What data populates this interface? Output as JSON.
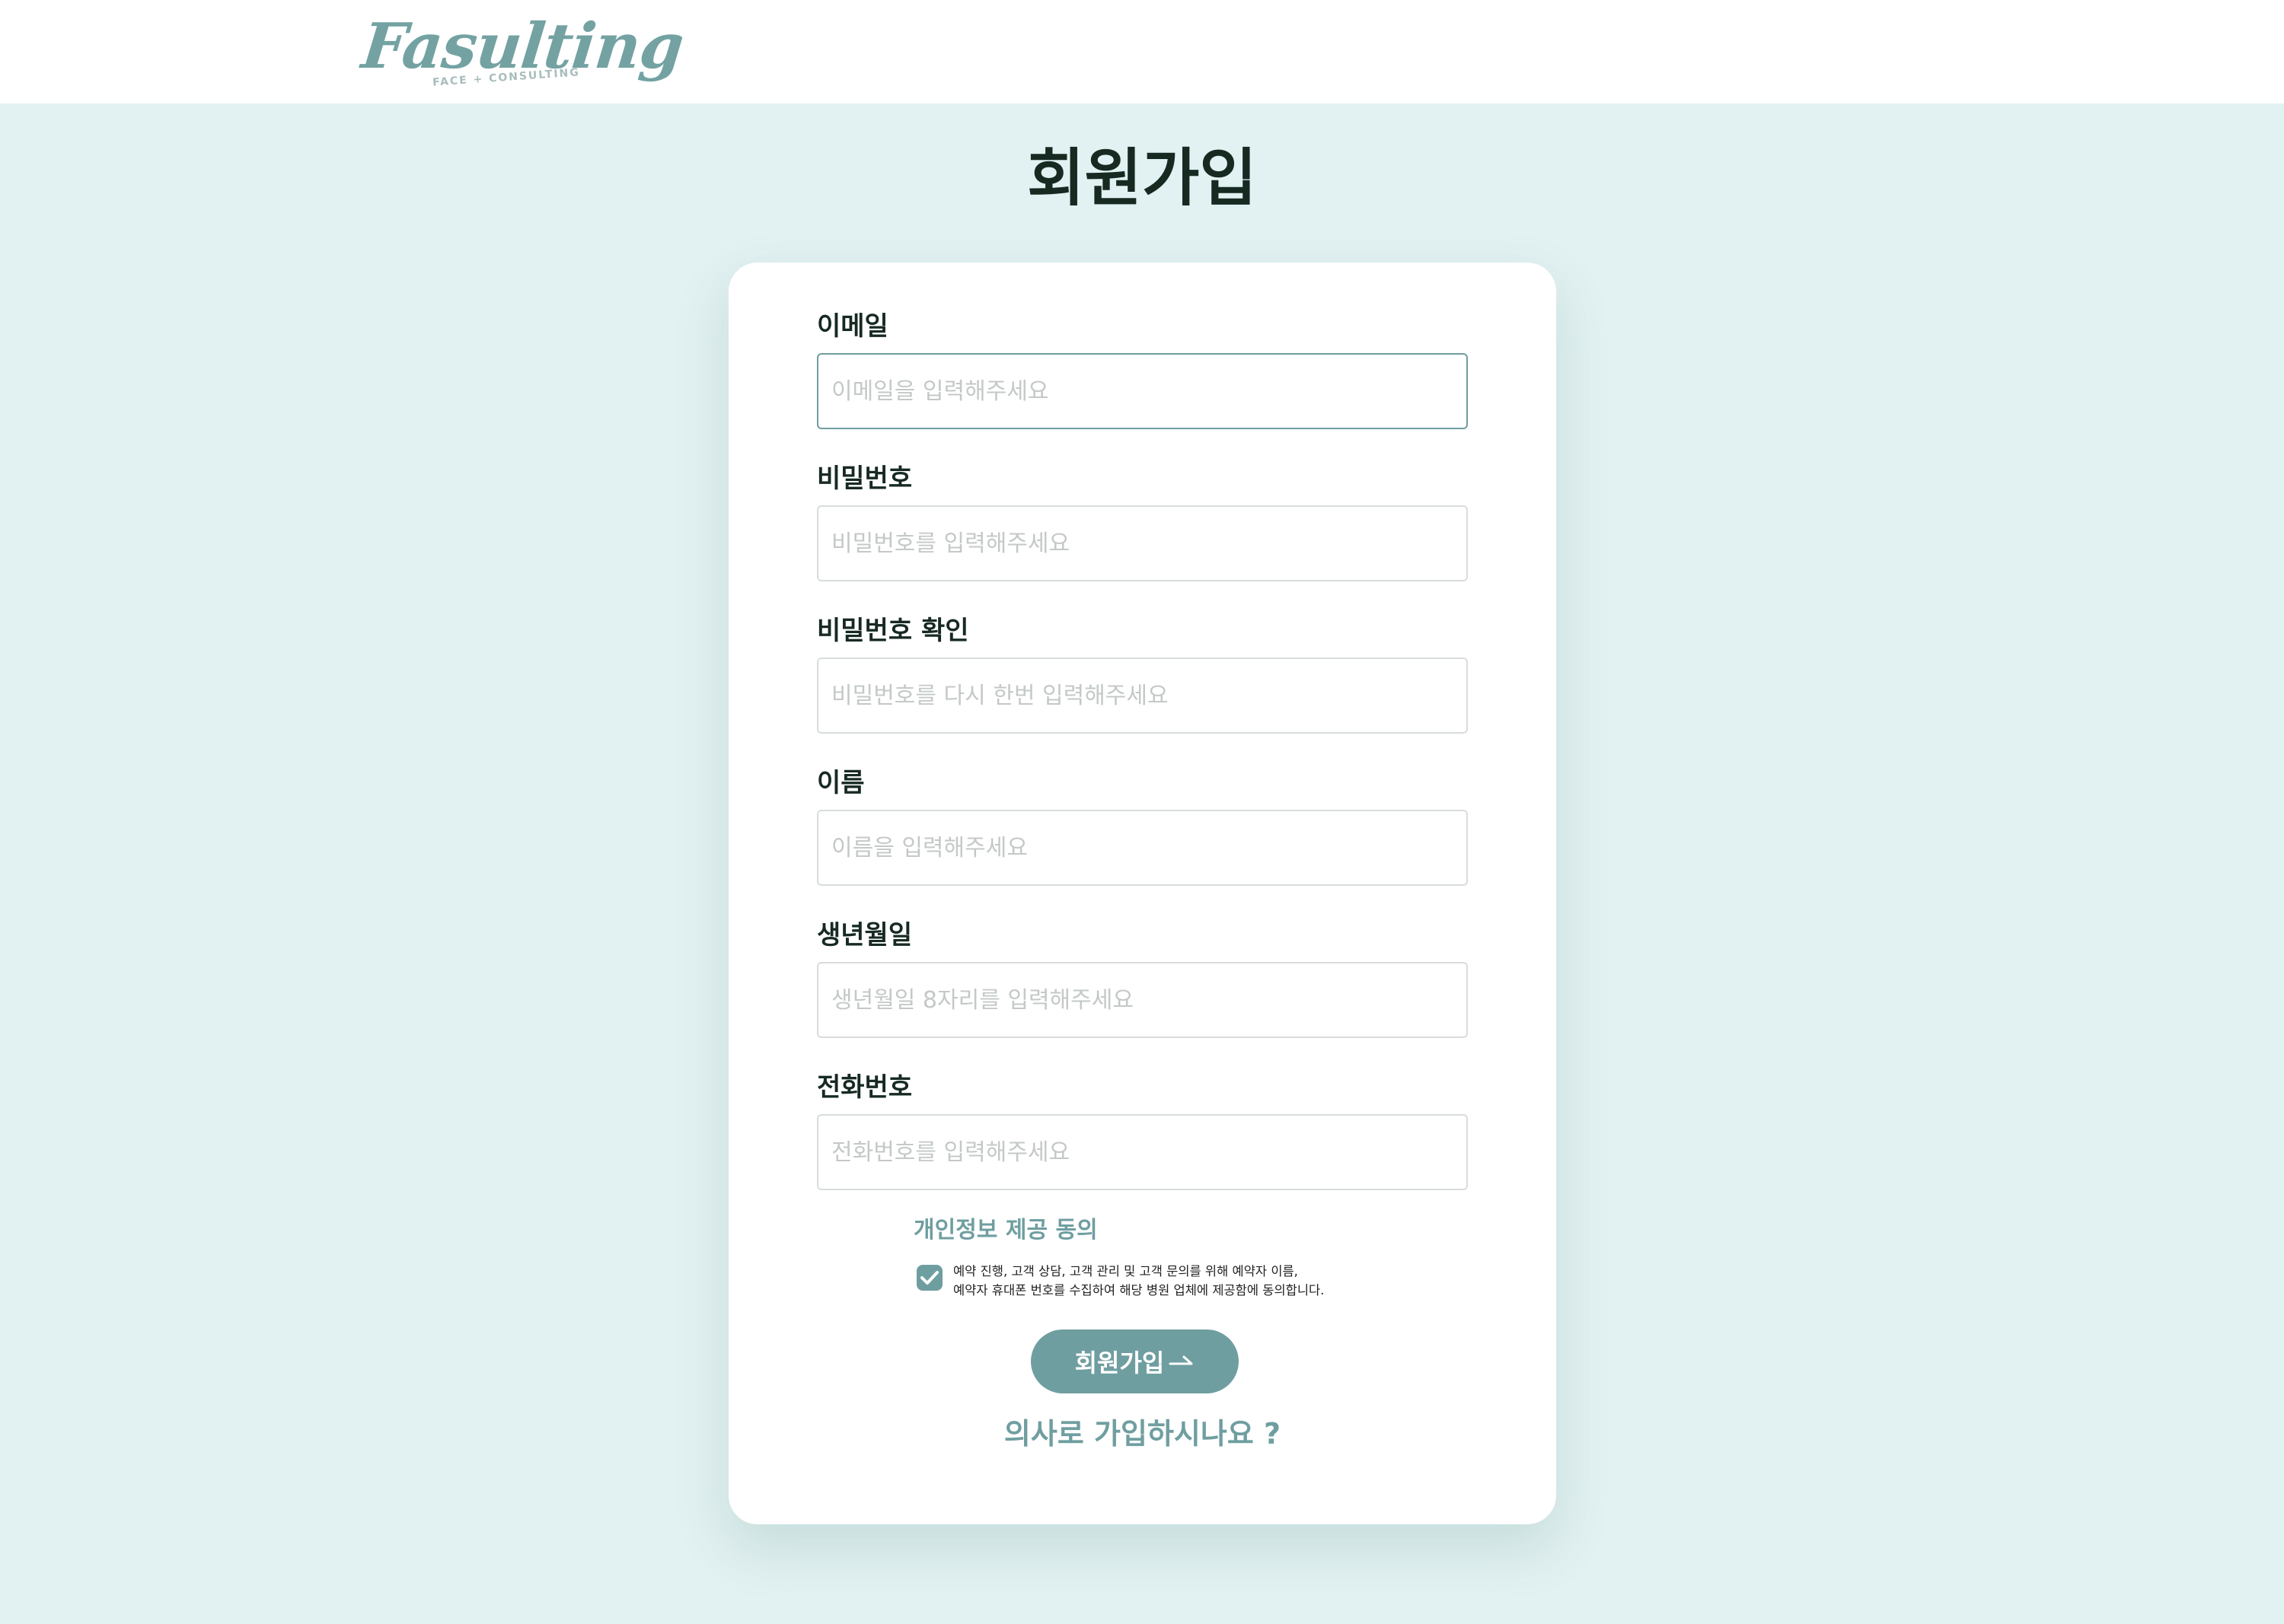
{
  "header": {
    "logo": {
      "word": "Fasulting",
      "tagline": "FACE + CONSULTING"
    }
  },
  "page": {
    "title": "회원가입"
  },
  "form": {
    "fields": [
      {
        "label": "이메일",
        "placeholder": "이메일을 입력해주세요",
        "value": ""
      },
      {
        "label": "비밀번호",
        "placeholder": "비밀번호를 입력해주세요",
        "value": ""
      },
      {
        "label": "비밀번호 확인",
        "placeholder": "비밀번호를 다시 한번 입력해주세요",
        "value": ""
      },
      {
        "label": "이름",
        "placeholder": "이름을 입력해주세요",
        "value": ""
      },
      {
        "label": "생년월일",
        "placeholder": "생년월일 8자리를 입력해주세요",
        "value": ""
      },
      {
        "label": "전화번호",
        "placeholder": "전화번호를 입력해주세요",
        "value": ""
      }
    ],
    "consent": {
      "title": "개인정보 제공 동의",
      "checked": true,
      "text_line1": "예약 진행, 고객 상담, 고객 관리 및 고객 문의를 위해 예약자 이름,",
      "text_line2": "예약자 휴대폰 번호를 수집하여 해당 병원 업체에 제공함에 동의합니다."
    },
    "submit_label": "회원가입",
    "submit_icon": "arrow-right-icon",
    "doctor_link": "의사로 가입하시나요 ?"
  },
  "colors": {
    "accent": "#6f9ea0",
    "page_background": "#e2f1f1",
    "card_background": "#ffffff",
    "title_text": "#172a22"
  }
}
